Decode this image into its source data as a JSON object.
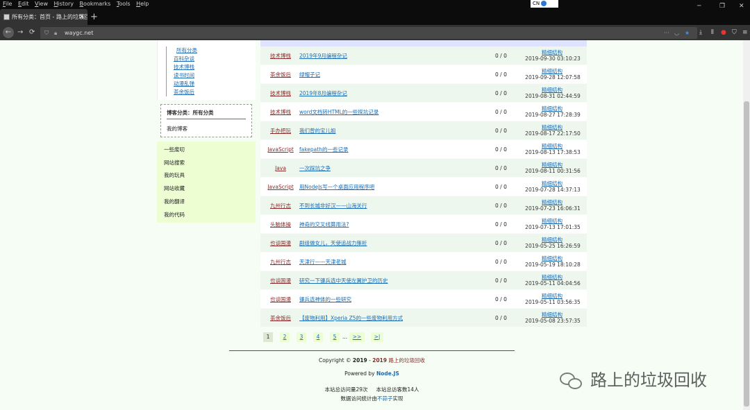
{
  "menubar": {
    "items": [
      {
        "label": "File",
        "u": "F",
        "rest": "ile"
      },
      {
        "label": "Edit",
        "u": "E",
        "rest": "dit"
      },
      {
        "label": "View",
        "u": "V",
        "rest": "iew"
      },
      {
        "label": "History",
        "u": "H",
        "rest": "istory"
      },
      {
        "label": "Bookmarks",
        "u": "B",
        "rest": "ookmarks"
      },
      {
        "label": "Tools",
        "u": "T",
        "rest": "ools"
      },
      {
        "label": "Help",
        "u": "H",
        "rest": "elp"
      }
    ],
    "ime": "CN"
  },
  "tab": {
    "title": "所有分类：首页 - 路上的垃圾回收",
    "close": "✕",
    "new": "+"
  },
  "window": {
    "minimize": "─",
    "restore": "❐",
    "close": "✕"
  },
  "nav": {
    "back": "←",
    "forward": "→",
    "url": "waygc.net"
  },
  "sidebar": {
    "tree_root": "所有分类",
    "tree_items": [
      "百科杂谈",
      "技术博栈",
      "读书时间",
      "动漫乱弹",
      "茶余饭后"
    ],
    "blog_heading": "博客分类：所有分类",
    "blog_item": "我的博客",
    "links": [
      "一些废叨",
      "网站搜索",
      "我的玩具",
      "网站收藏",
      "我的翻译",
      "我的代码"
    ]
  },
  "posts": [
    {
      "cat": "技术博栈",
      "title": "2019年9月编程杂记",
      "count": "0 / 0",
      "author": "精细结构",
      "time": "2019-09-30 03:10:23"
    },
    {
      "cat": "茶余饭后",
      "title": "绿帽子记",
      "count": "0 / 0",
      "author": "精细结构",
      "time": "2019-09-28 12:07:58"
    },
    {
      "cat": "技术博栈",
      "title": "2019年8月编程杂记",
      "count": "0 / 0",
      "author": "精细结构",
      "time": "2019-08-31 02:44:59"
    },
    {
      "cat": "技术博栈",
      "title": "word文档转HTML的一些探坑记录",
      "count": "0 / 0",
      "author": "精细结构",
      "time": "2019-08-27 17:28:39"
    },
    {
      "cat": "手办把玩",
      "title": "我们曾的宝儿姐",
      "count": "0 / 0",
      "author": "精细结构",
      "time": "2019-08-17 22:17:50"
    },
    {
      "cat": "JavaScript",
      "title": "fakepath的一些记录",
      "count": "0 / 0",
      "author": "精细结构",
      "time": "2019-08-13 17:38:53"
    },
    {
      "cat": "Java",
      "title": "一次踩坑之争",
      "count": "0 / 0",
      "author": "精细结构",
      "time": "2019-08-11 00:31:56"
    },
    {
      "cat": "JavaScript",
      "title": "用NodeJs写一个桌面应用程序吧",
      "count": "0 / 0",
      "author": "精细结构",
      "time": "2019-07-28 14:37:13"
    },
    {
      "cat": "九州行志",
      "title": "不到长城非好汉——山海关行",
      "count": "0 / 0",
      "author": "精细结构",
      "time": "2019-07-23 16:06:31"
    },
    {
      "cat": "头脑体操",
      "title": "神奇的交叉线算用法?",
      "count": "0 / 0",
      "author": "精细结构",
      "time": "2019-07-13 17:01:35"
    },
    {
      "cat": "也谈国漫",
      "title": "剧组做女儿，天使追战力策析",
      "count": "0 / 0",
      "author": "精细结构",
      "time": "2019-05-25 16:26:59"
    },
    {
      "cat": "九州行志",
      "title": "天津行——天津老城",
      "count": "0 / 0",
      "author": "精细结构",
      "time": "2019-05-19 18:10:28"
    },
    {
      "cat": "也谈国漫",
      "title": "研究一下镰兵选中天使左翼护卫的历史",
      "count": "0 / 0",
      "author": "精细结构",
      "time": "2019-05-11 04:04:56"
    },
    {
      "cat": "也谈国漫",
      "title": "镰兵选神体的一些研究",
      "count": "0 / 0",
      "author": "精细结构",
      "time": "2019-05-11 03:56:35"
    },
    {
      "cat": "茶余饭后",
      "title": "【废物利用】Xperia Z5的一些废物利用方式",
      "count": "0 / 0",
      "author": "精细结构",
      "time": "2019-05-08 23:57:35"
    }
  ],
  "pager": {
    "pages": [
      "1",
      "2",
      "3",
      "4",
      "5"
    ],
    "dots": "...",
    "next": ">>",
    "last": ">|"
  },
  "footer": {
    "copy_prefix": "Copyright © ",
    "year_start": "2019",
    "year_sep": " - ",
    "year_end": "2019",
    "site": "路上的垃圾回收",
    "powered_prefix": "Powered by ",
    "powered": "Node.JS",
    "visits": "本站总访问量29次",
    "visitors": "本站总访客数14人",
    "stats_prefix": "数据访问统计由",
    "stats_link": "不蒜子",
    "stats_suffix": "实现"
  },
  "watermark": "路上的垃圾回收"
}
